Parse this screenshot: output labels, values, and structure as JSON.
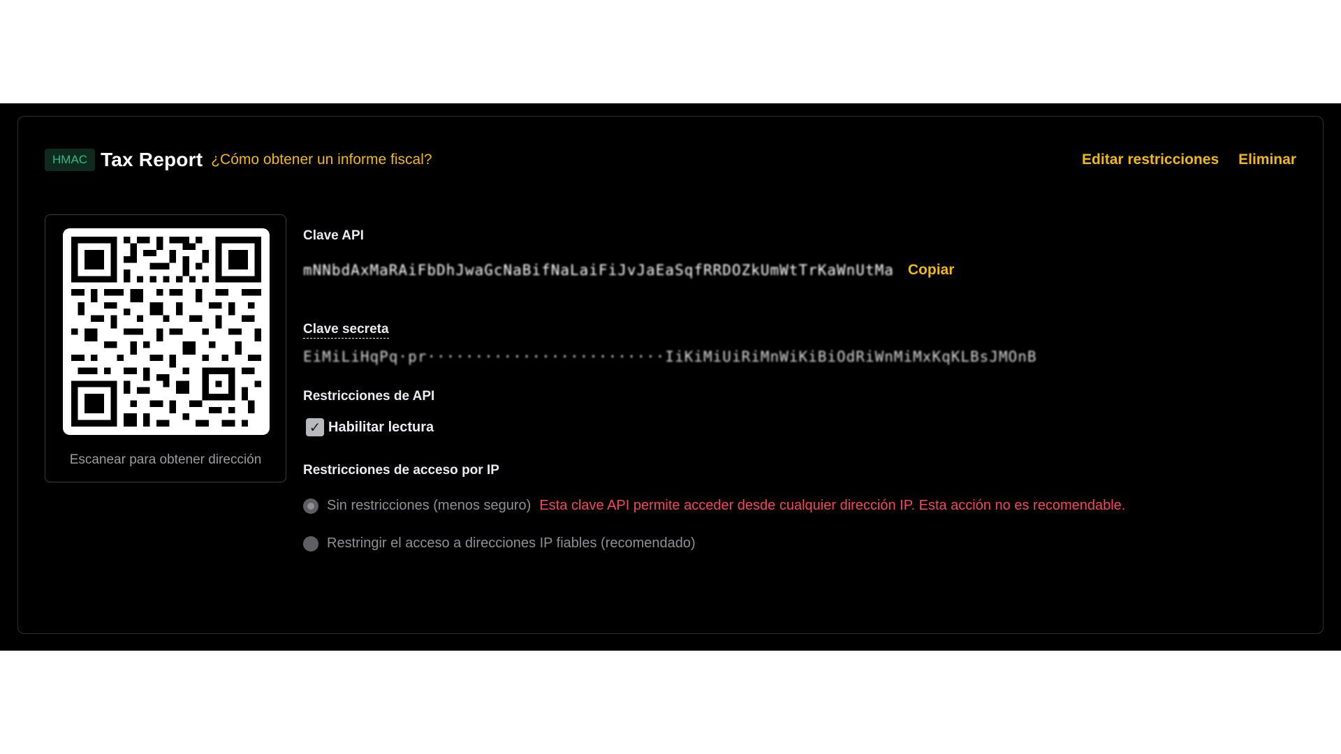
{
  "header": {
    "badge": "HMAC",
    "title": "Tax Report",
    "help_link": "¿Cómo obtener un informe fiscal?",
    "edit_label": "Editar restricciones",
    "delete_label": "Eliminar"
  },
  "qr": {
    "caption": "Escanear para obtener dirección"
  },
  "api_key": {
    "label": "Clave API",
    "value": "mNNbdAxMaRAiFbDhJwaGcNaBifNaLaiFiJvJaEaSqfRRDOZkUmWtTrKaWnUtMa",
    "copy_label": "Copiar"
  },
  "secret_key": {
    "label": "Clave secreta",
    "value": "EiMiLiHqPq·pr·························IiKiMiUiRiMnWiKiBiOdRiWnMiMxKqKLBsJMOnB"
  },
  "restrictions": {
    "label": "Restricciones de API",
    "enable_read": {
      "label": "Habilitar lectura",
      "checked": "true"
    }
  },
  "ip_restrictions": {
    "label": "Restricciones de acceso por IP",
    "option_none": "Sin restricciones (menos seguro)",
    "option_none_warning": "Esta clave API permite acceder desde cualquier dirección IP. Esta acción no es recomendable.",
    "option_trusted": "Restringir el acceso a direcciones IP fiables (recomendado)"
  },
  "colors": {
    "accent": "#f0b90b",
    "badge_text": "#2ebd85",
    "warning": "#f6465d"
  }
}
